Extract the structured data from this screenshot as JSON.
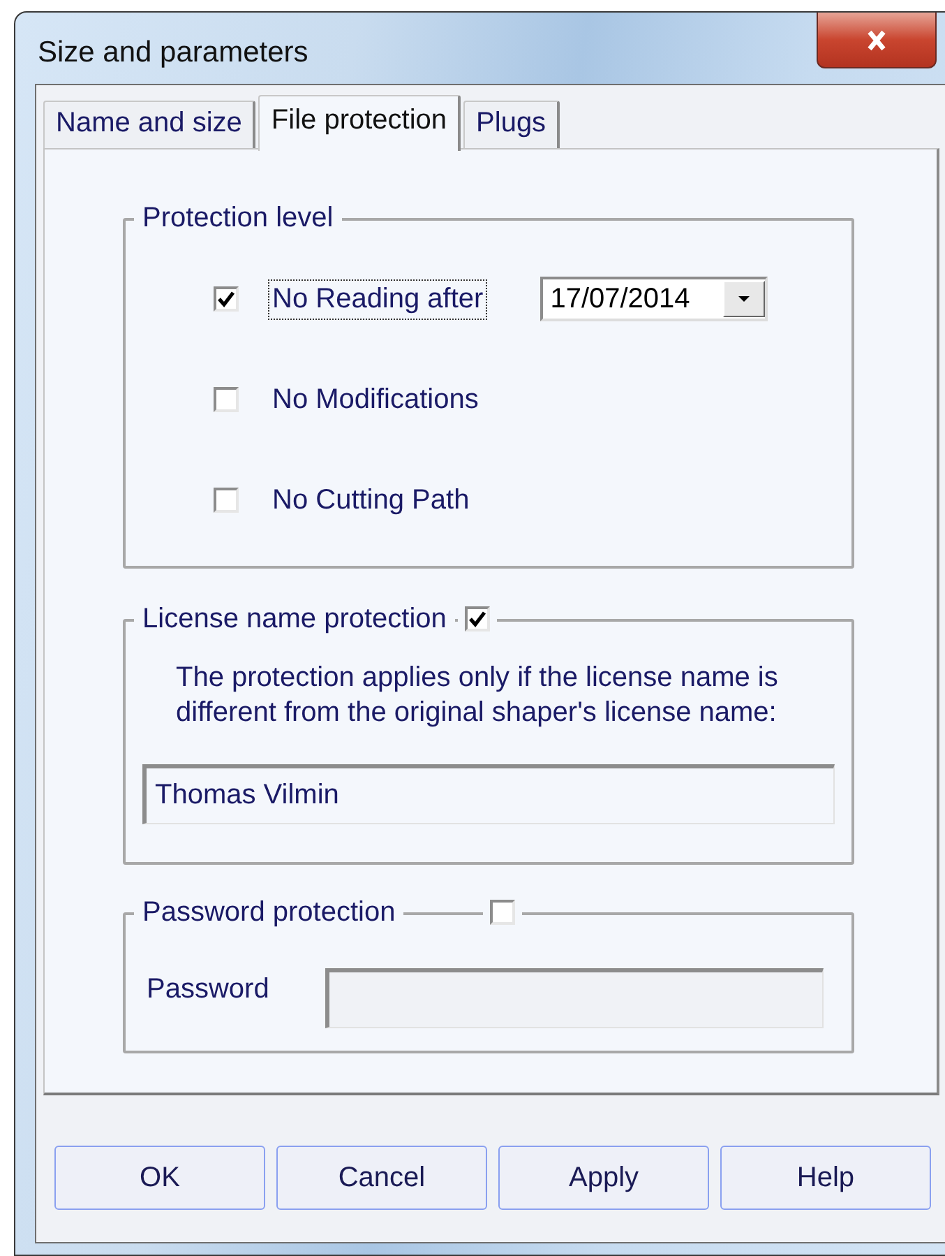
{
  "window": {
    "title": "Size and parameters"
  },
  "tabs": [
    {
      "label": "Name and size",
      "selected": false
    },
    {
      "label": "File protection",
      "selected": true
    },
    {
      "label": "Plugs",
      "selected": false
    }
  ],
  "protection_level": {
    "title": "Protection level",
    "options": [
      {
        "label": "No Reading after",
        "checked": true,
        "focused": true,
        "date": "17/07/2014"
      },
      {
        "label": "No Modifications",
        "checked": false,
        "focused": false
      },
      {
        "label": "No Cutting Path",
        "checked": false,
        "focused": false
      }
    ]
  },
  "license_protection": {
    "title": "License name protection",
    "checked": true,
    "note": "The protection applies only if the license name is different from the original shaper's license name:",
    "value": "Thomas Vilmin"
  },
  "password_protection": {
    "title": "Password protection",
    "checked": false,
    "label": "Password"
  },
  "buttons": [
    "OK",
    "Cancel",
    "Apply",
    "Help"
  ]
}
